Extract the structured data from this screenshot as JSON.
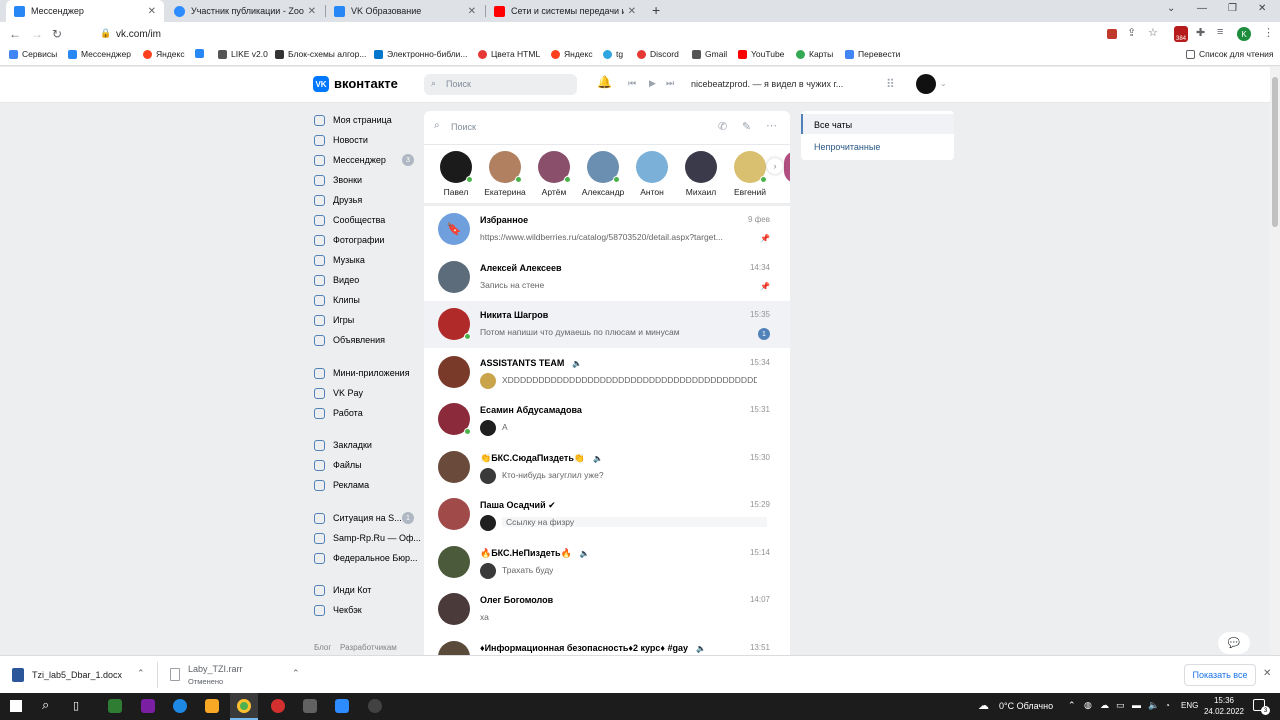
{
  "browser": {
    "tabs": [
      {
        "label": "Мессенджер",
        "active": true,
        "color": "#2787f5"
      },
      {
        "label": "Участник публикации - Zoom",
        "active": false,
        "color": "#2d8cff"
      },
      {
        "label": "VK Образование",
        "active": false,
        "color": "#2787f5"
      },
      {
        "label": "Сети и системы передачи инфо",
        "active": false,
        "color": "#ff0000"
      }
    ],
    "new_tab": "+",
    "url": "vk.com/im",
    "bookmarks": [
      {
        "label": "Сервисы",
        "color": "#4285f4"
      },
      {
        "label": "Мессенджер",
        "color": "#2787f5"
      },
      {
        "label": "Яндекс",
        "color": "#fc3f1d"
      },
      {
        "label": "",
        "color": "#2787f5"
      },
      {
        "label": "LIKE v2.0",
        "color": "#555555"
      },
      {
        "label": "Блок-схемы алгор...",
        "color": "#333333"
      },
      {
        "label": "Электронно-библи...",
        "color": "#0077cc"
      },
      {
        "label": "Цвета HTML",
        "color": "#e53935"
      },
      {
        "label": "Яндекс",
        "color": "#fc3f1d"
      },
      {
        "label": "tg",
        "color": "#2ca5e0"
      },
      {
        "label": "Discord",
        "color": "#e53935"
      },
      {
        "label": "Gmail",
        "color": "#555555"
      },
      {
        "label": "YouTube",
        "color": "#ff0000"
      },
      {
        "label": "Карты",
        "color": "#34a853"
      },
      {
        "label": "Перевести",
        "color": "#4285f4"
      }
    ],
    "reading_list": "Список для чтения",
    "profile_letter": "K",
    "ext_badge": "384"
  },
  "vk": {
    "logo": "вконтакте",
    "search_placeholder": "Поиск",
    "now_playing": "nicebeatzprod. — я видел в чужих г...",
    "nav": [
      {
        "label": "Моя страница",
        "badge": ""
      },
      {
        "label": "Новости",
        "badge": ""
      },
      {
        "label": "Мессенджер",
        "badge": "3"
      },
      {
        "label": "Звонки",
        "badge": ""
      },
      {
        "label": "Друзья",
        "badge": ""
      },
      {
        "label": "Сообщества",
        "badge": ""
      },
      {
        "label": "Фотографии",
        "badge": ""
      },
      {
        "label": "Музыка",
        "badge": ""
      },
      {
        "label": "Видео",
        "badge": ""
      },
      {
        "label": "Клипы",
        "badge": ""
      },
      {
        "label": "Игры",
        "badge": ""
      },
      {
        "label": "Объявления",
        "badge": ""
      }
    ],
    "nav2": [
      {
        "label": "Мини-приложения",
        "badge": ""
      },
      {
        "label": "VK Pay",
        "badge": ""
      },
      {
        "label": "Работа",
        "badge": ""
      }
    ],
    "nav3": [
      {
        "label": "Закладки",
        "badge": ""
      },
      {
        "label": "Файлы",
        "badge": ""
      },
      {
        "label": "Реклама",
        "badge": ""
      }
    ],
    "nav4": [
      {
        "label": "Ситуация на S...",
        "badge": "1"
      },
      {
        "label": "Samp-Rp.Ru — Оф...",
        "badge": ""
      },
      {
        "label": "Федеральное Бюр...",
        "badge": ""
      }
    ],
    "nav5": [
      {
        "label": "Инди Кот",
        "badge": ""
      },
      {
        "label": "Чекбэк",
        "badge": ""
      }
    ],
    "footer_links": [
      "Блог",
      "Разработчикам"
    ],
    "chat_search_placeholder": "Поиск",
    "stories": [
      {
        "name": "Павел",
        "color": "#1b1b1b",
        "online": true
      },
      {
        "name": "Екатерина",
        "color": "#b08060",
        "online": true
      },
      {
        "name": "Артём",
        "color": "#8a4f6a",
        "online": true
      },
      {
        "name": "Александр",
        "color": "#6b8fb0",
        "online": true
      },
      {
        "name": "Антон",
        "color": "#7bb0d8",
        "online": false
      },
      {
        "name": "Михаил",
        "color": "#3a3a4a",
        "online": false
      },
      {
        "name": "Евгений",
        "color": "#d8c070",
        "online": true
      }
    ],
    "conversations": [
      {
        "name": "Избранное",
        "time": "9 фев",
        "preview": "https://www.wildberries.ru/catalog/58703520/detail.aspx?target...",
        "pinned": true,
        "badge": "",
        "color": "#6f9fdc",
        "online": false,
        "preview_av": "",
        "muted": "",
        "selected": false
      },
      {
        "name": "Алексей Алексеев",
        "time": "14:34",
        "preview": "Запись на стене",
        "pinned": true,
        "badge": "",
        "color": "#5c6c7a",
        "online": false,
        "preview_av": "",
        "muted": "",
        "selected": false
      },
      {
        "name": "Никита Шагров",
        "time": "15:35",
        "preview": "Потом напиши что думаешь по плюсам и минусам",
        "pinned": false,
        "badge": "1",
        "color": "#b02a2a",
        "online": true,
        "preview_av": "",
        "muted": "",
        "selected": true
      },
      {
        "name": "ASSISTANTS TEAM",
        "time": "15:34",
        "preview": "XDDDDDDDDDDDDDDDDDDDDDDDDDDDDDDDDDDDDDDDDD...",
        "pinned": false,
        "badge": "",
        "color": "#7a3a2a",
        "online": false,
        "preview_av": "#c9a44a",
        "muted": "🔈",
        "selected": false
      },
      {
        "name": "Есамин Абдусамадова",
        "time": "15:31",
        "preview": "А",
        "pinned": false,
        "badge": "",
        "color": "#8a2a3a",
        "online": true,
        "preview_av": "#1f1f1f",
        "muted": "",
        "selected": false
      },
      {
        "name": "👏БКС.СюдаПиздеть👏",
        "time": "15:30",
        "preview": "Кто-нибудь загуглил уже?",
        "pinned": false,
        "badge": "",
        "color": "#6a4a3a",
        "online": false,
        "preview_av": "#3a3a3a",
        "muted": "🔈",
        "selected": false
      },
      {
        "name": "Паша Осадчий ✔",
        "time": "15:29",
        "preview": "Ссылку на физру",
        "pinned": false,
        "badge": "",
        "color": "#a04a4a",
        "online": false,
        "preview_av": "#1f1f1f",
        "muted": "",
        "selected": false
      },
      {
        "name": "🔥БКС.НеПиздеть🔥",
        "time": "15:14",
        "preview": "Трахать буду",
        "pinned": false,
        "badge": "",
        "color": "#4a5a3a",
        "online": false,
        "preview_av": "#3a3a3a",
        "muted": "🔈",
        "selected": false
      },
      {
        "name": "Олег Богомолов",
        "time": "14:07",
        "preview": "ха",
        "pinned": false,
        "badge": "",
        "color": "#4a3a3a",
        "online": false,
        "preview_av": "",
        "muted": "",
        "selected": false
      },
      {
        "name": "♦Информационная безопасность♦2 курс♦ #gay",
        "time": "13:51",
        "preview": "",
        "pinned": false,
        "badge": "",
        "color": "#5a4a3a",
        "online": false,
        "preview_av": "",
        "muted": "🔈",
        "selected": false
      }
    ],
    "folders": [
      {
        "label": "Все чаты",
        "active": true
      },
      {
        "label": "Непрочитанные",
        "active": false
      }
    ]
  },
  "downloads": {
    "items": [
      {
        "name": "Tzi_lab5_Dbar_1.docx",
        "status": ""
      },
      {
        "name": "Laby_TZI.rarr",
        "status": "Отменено"
      }
    ],
    "show_all": "Показать все"
  },
  "taskbar": {
    "weather": "0°C  Облачно",
    "lang": "ENG",
    "time": "15:36",
    "date": "24.02.2022",
    "notif": "3"
  },
  "colors": {
    "accent": "#5181b8",
    "vk_blue": "#0077ff"
  }
}
